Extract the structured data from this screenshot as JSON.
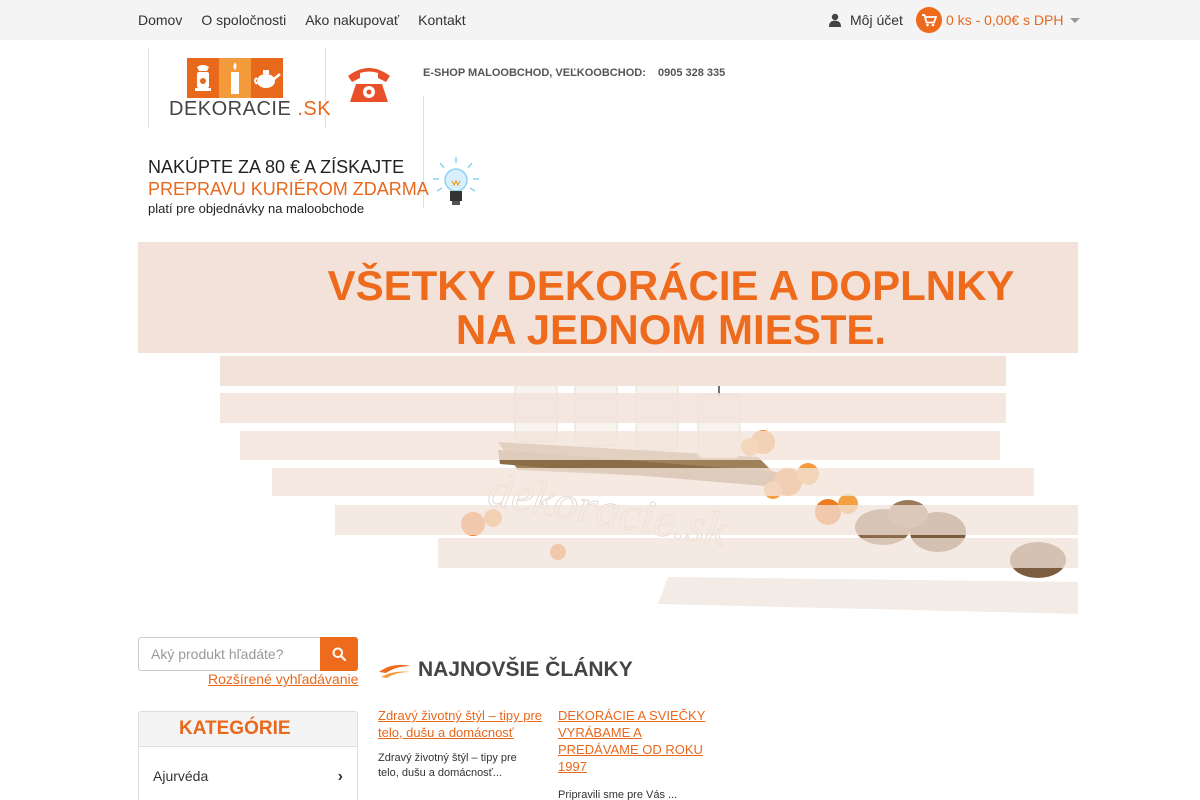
{
  "nav": {
    "items": [
      "Domov",
      "O spoločnosti",
      "Ako nakupovať",
      "Kontakt"
    ]
  },
  "account": {
    "label": "Môj účet"
  },
  "cart": {
    "summary": "0 ks - 0,00€ s DPH"
  },
  "logo": {
    "main": "DEKORACIE",
    "suffix": ".SK"
  },
  "header": {
    "eshop_label": "E-SHOP MALOOBCHOD, VEĽKOOBCHOD:",
    "phone": "0905 328 335"
  },
  "promo": {
    "line1": "NAKÚPTE ZA 80 € A ZÍSKAJTE",
    "line2": "PREPRAVU KURIÉROM ZDARMA",
    "line3": "platí pre objednávky na maloobchode"
  },
  "banner": {
    "line1": "VŠETKY DEKORÁCIE A DOPLNKY",
    "line2": "NA JEDNOM MIESTE."
  },
  "search": {
    "placeholder": "Aký produkt hľadáte?",
    "advanced_label": "Rozšírené vyhľadávanie"
  },
  "categories": {
    "title": "KATEGÓRIE",
    "items": [
      "Ajurvéda"
    ]
  },
  "articles": {
    "title": "NAJNOVŠIE ČLÁNKY",
    "items": [
      {
        "title": "Zdravý životný štýl – tipy pre telo, dušu a domácnosť",
        "excerpt": "Zdravý životný štýl – tipy pre telo, dušu a domácnosť..."
      },
      {
        "title": "DEKORÁCIE A SVIEČKY VYRÁBAME A PREDÁVAME OD ROKU 1997",
        "excerpt": "Pripravili sme pre Vás ..."
      }
    ]
  },
  "colors": {
    "accent": "#ee6a1c",
    "topbar": "#f4f4f4",
    "banner_bg": "#f3e2d9"
  },
  "icons": [
    "user-icon",
    "cart-icon",
    "phone-icon",
    "lightbulb-icon",
    "search-icon",
    "chevron-right-icon",
    "articles-swoosh-icon"
  ]
}
